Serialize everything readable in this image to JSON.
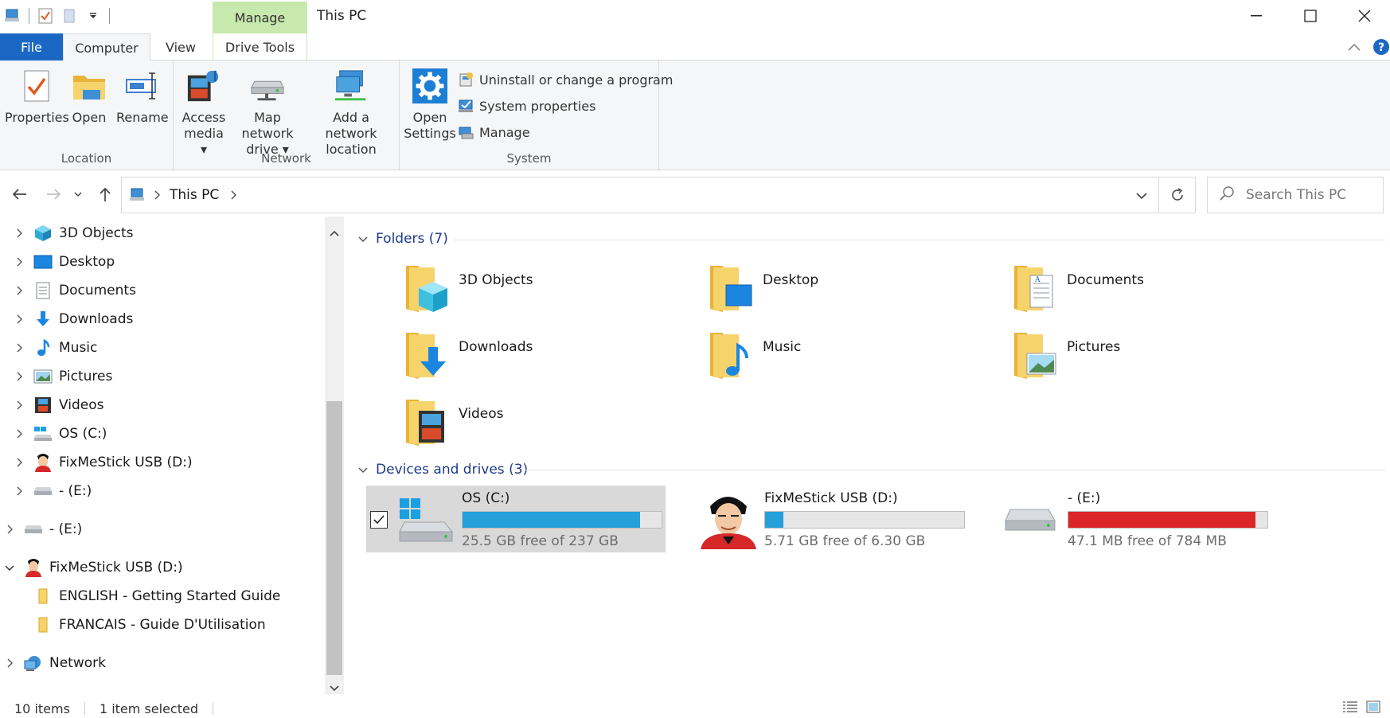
{
  "window": {
    "title": "This PC",
    "context_tab_header": "Manage"
  },
  "ribbon_tabs": {
    "file": "File",
    "computer": "Computer",
    "view": "View",
    "drive_tools": "Drive Tools"
  },
  "ribbon": {
    "location": {
      "label": "Location",
      "properties": "Properties",
      "open": "Open",
      "rename": "Rename"
    },
    "network": {
      "label": "Network",
      "access_media_1": "Access",
      "access_media_2": "media",
      "map_drive_1": "Map network",
      "map_drive_2": "drive",
      "add_location_1": "Add a network",
      "add_location_2": "location"
    },
    "system": {
      "label": "System",
      "open_settings_1": "Open",
      "open_settings_2": "Settings",
      "uninstall": "Uninstall or change a program",
      "system_properties": "System properties",
      "manage": "Manage"
    }
  },
  "address": {
    "path": "This PC",
    "search_placeholder": "Search This PC"
  },
  "nav_pane": {
    "items": [
      {
        "label": "3D Objects"
      },
      {
        "label": "Desktop"
      },
      {
        "label": "Documents"
      },
      {
        "label": "Downloads"
      },
      {
        "label": "Music"
      },
      {
        "label": "Pictures"
      },
      {
        "label": "Videos"
      },
      {
        "label": "OS (C:)"
      },
      {
        "label": "FixMeStick USB (D:)"
      },
      {
        "label": "- (E:)"
      },
      {
        "label": "- (E:)"
      },
      {
        "label": "FixMeStick USB (D:)"
      },
      {
        "label": "ENGLISH - Getting Started Guide"
      },
      {
        "label": "FRANCAIS - Guide D'Utilisation"
      },
      {
        "label": "Network"
      }
    ]
  },
  "content": {
    "folders_header": "Folders (7)",
    "folders": [
      {
        "name": "3D Objects"
      },
      {
        "name": "Desktop"
      },
      {
        "name": "Documents"
      },
      {
        "name": "Downloads"
      },
      {
        "name": "Music"
      },
      {
        "name": "Pictures"
      },
      {
        "name": "Videos"
      }
    ],
    "drives_header": "Devices and drives (3)",
    "drives": [
      {
        "name": "OS (C:)",
        "free": "25.5 GB free of 237 GB",
        "used_fraction": 0.89,
        "bar_color": "#26a0da",
        "selected": true
      },
      {
        "name": "FixMeStick USB (D:)",
        "free": "5.71 GB free of 6.30 GB",
        "used_fraction": 0.09,
        "bar_color": "#26a0da",
        "selected": false
      },
      {
        "name": "- (E:)",
        "free": "47.1 MB free of 784 MB",
        "used_fraction": 0.94,
        "bar_color": "#da2626",
        "selected": false
      }
    ]
  },
  "status": {
    "item_count": "10 items",
    "selection": "1 item selected"
  },
  "colors": {
    "file_tab": "#1b68c4",
    "context_tab": "#c7e9ad",
    "accent_blue": "#26a0da",
    "warn_red": "#da2626",
    "folder_yellow": "#f6d36b"
  }
}
